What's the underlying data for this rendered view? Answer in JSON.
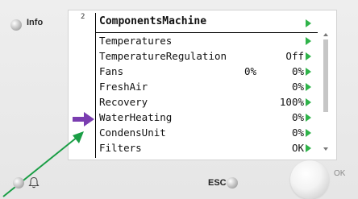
{
  "status": {
    "info_label": "Info",
    "menu_level": "2"
  },
  "menu": {
    "title": "ComponentsMachine",
    "items": [
      {
        "label": "Temperatures",
        "value": "",
        "value2": ""
      },
      {
        "label": "TemperatureRegulation",
        "value": "",
        "value2": "Off"
      },
      {
        "label": "Fans",
        "value": "0%",
        "value2": "0%"
      },
      {
        "label": "FreshAir",
        "value": "",
        "value2": "0%"
      },
      {
        "label": "Recovery",
        "value": "",
        "value2": "100%"
      },
      {
        "label": "WaterHeating",
        "value": "",
        "value2": "0%"
      },
      {
        "label": "CondensUnit",
        "value": "",
        "value2": "0%"
      },
      {
        "label": "Filters",
        "value": "",
        "value2": "OK"
      }
    ]
  },
  "controls": {
    "esc_label": "ESC",
    "ok_label": "OK"
  },
  "colors": {
    "green_triangle": "#2fb34a",
    "purple_arrow": "#7a3db0",
    "green_arrow": "#1a9e45"
  }
}
